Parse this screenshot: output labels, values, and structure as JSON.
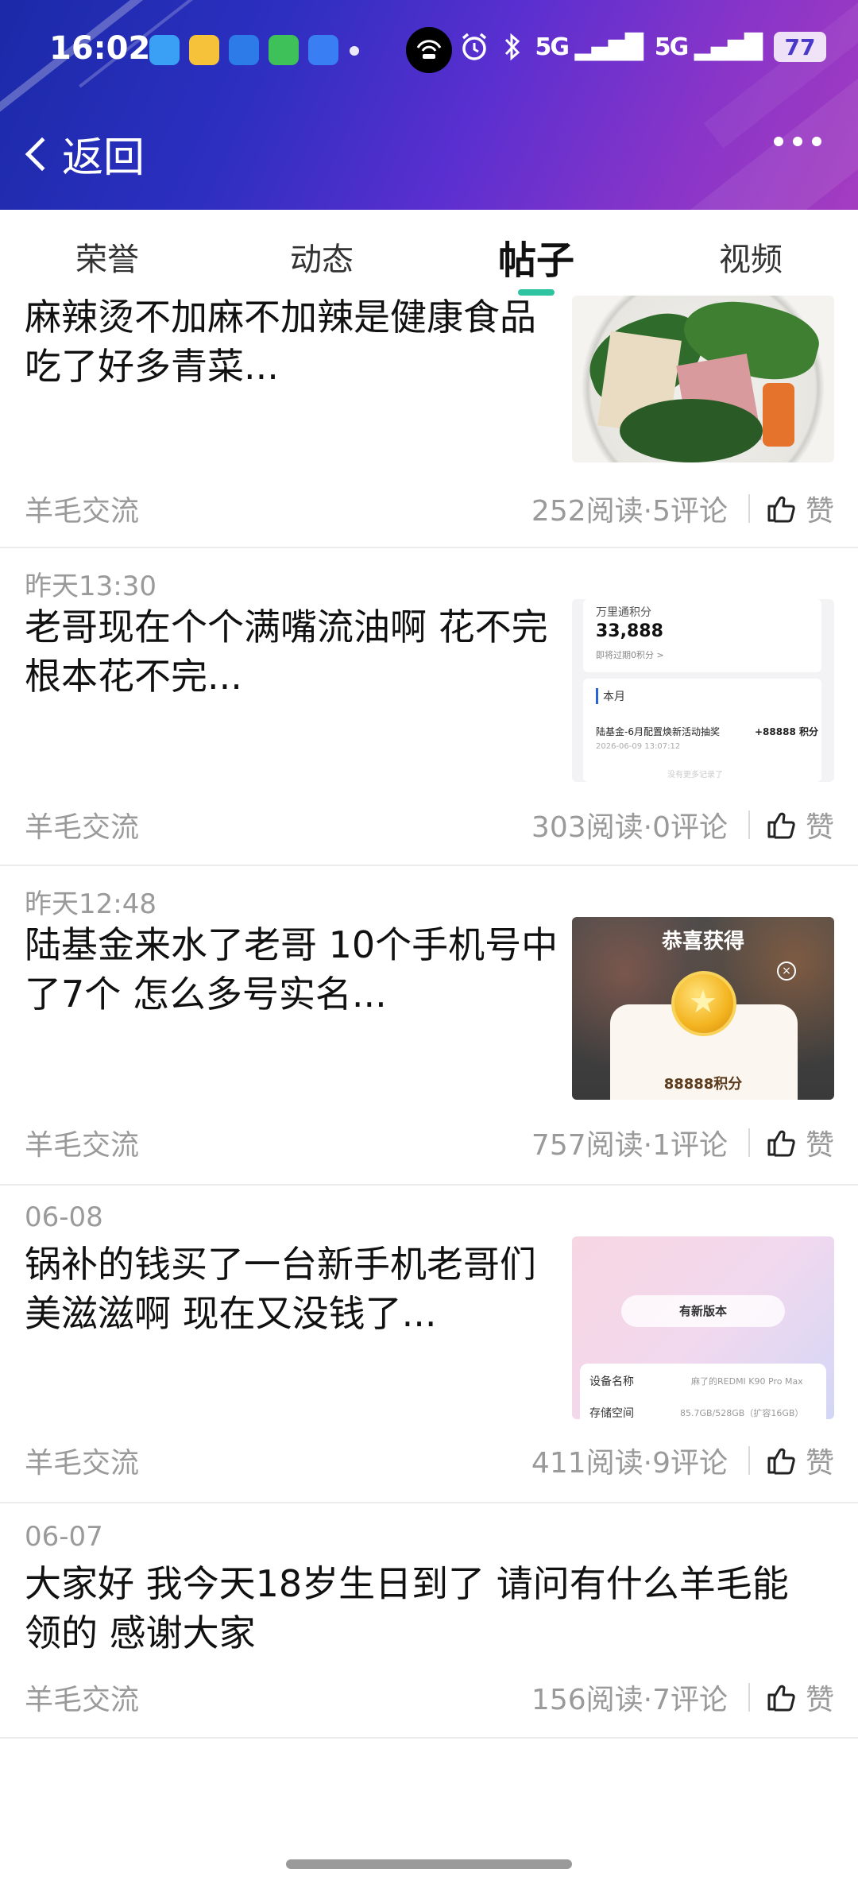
{
  "status_bar": {
    "time": "16:02",
    "signal_1": "5G",
    "signal_2": "5G",
    "battery": "77"
  },
  "nav": {
    "back_label": "返回"
  },
  "tabs": [
    {
      "label": "荣誉",
      "active": false
    },
    {
      "label": "动态",
      "active": false
    },
    {
      "label": "帖子",
      "active": true
    },
    {
      "label": "视频",
      "active": false
    }
  ],
  "posts": [
    {
      "date": "",
      "title_line1": "麻辣烫不加麻不加辣是健康食品",
      "title_line2": "吃了好多青菜...",
      "category": "羊毛交流",
      "stats": "252阅读·5评论",
      "like_label": "赞"
    },
    {
      "date": "昨天13:30",
      "title_line1": "老哥现在个个满嘴流油啊 花不完",
      "title_line2": "根本花不完...",
      "category": "羊毛交流",
      "stats": "303阅读·0评论",
      "like_label": "赞",
      "thumb": {
        "label": "万里通积分",
        "points": "33,888",
        "expire": "即将过期0积分 >",
        "month": "本月",
        "item": "陆基金-6月配置焕新活动抽奖",
        "item_points": "+88888 积分",
        "item_date": "2026-06-09 13:07:12",
        "no_more": "没有更多记录了"
      }
    },
    {
      "date": "昨天12:48",
      "title_line1": "陆基金来水了老哥 10个手机号中",
      "title_line2": "了7个 怎么多号实名...",
      "category": "羊毛交流",
      "stats": "757阅读·1评论",
      "like_label": "赞",
      "thumb": {
        "heading": "恭喜获得",
        "close": "×",
        "amount": "88888积分"
      }
    },
    {
      "date": "06-08",
      "title_line1": "锅补的钱买了一台新手机老哥们",
      "title_line2": "美滋滋啊 现在又没钱了...",
      "category": "羊毛交流",
      "stats": "411阅读·9评论",
      "like_label": "赞",
      "thumb": {
        "button": "有新版本",
        "row1_label": "设备名称",
        "row1_value": "麻了的REDMI K90 Pro Max",
        "row2_label": "存储空间",
        "row2_value": "85.7GB/528GB（扩容16GB）"
      }
    },
    {
      "date": "06-07",
      "title_line1": "大家好 我今天18岁生日到了 请问有什么羊毛能",
      "title_line2": "领的 感谢大家",
      "category": "羊毛交流",
      "stats": "156阅读·7评论",
      "like_label": "赞"
    }
  ],
  "colors": {
    "header_gradient_start": "#1b2aa8",
    "header_gradient_end": "#a43cc0",
    "tab_indicator": "#2ec4a0",
    "meta_text": "#9a9a9a"
  }
}
